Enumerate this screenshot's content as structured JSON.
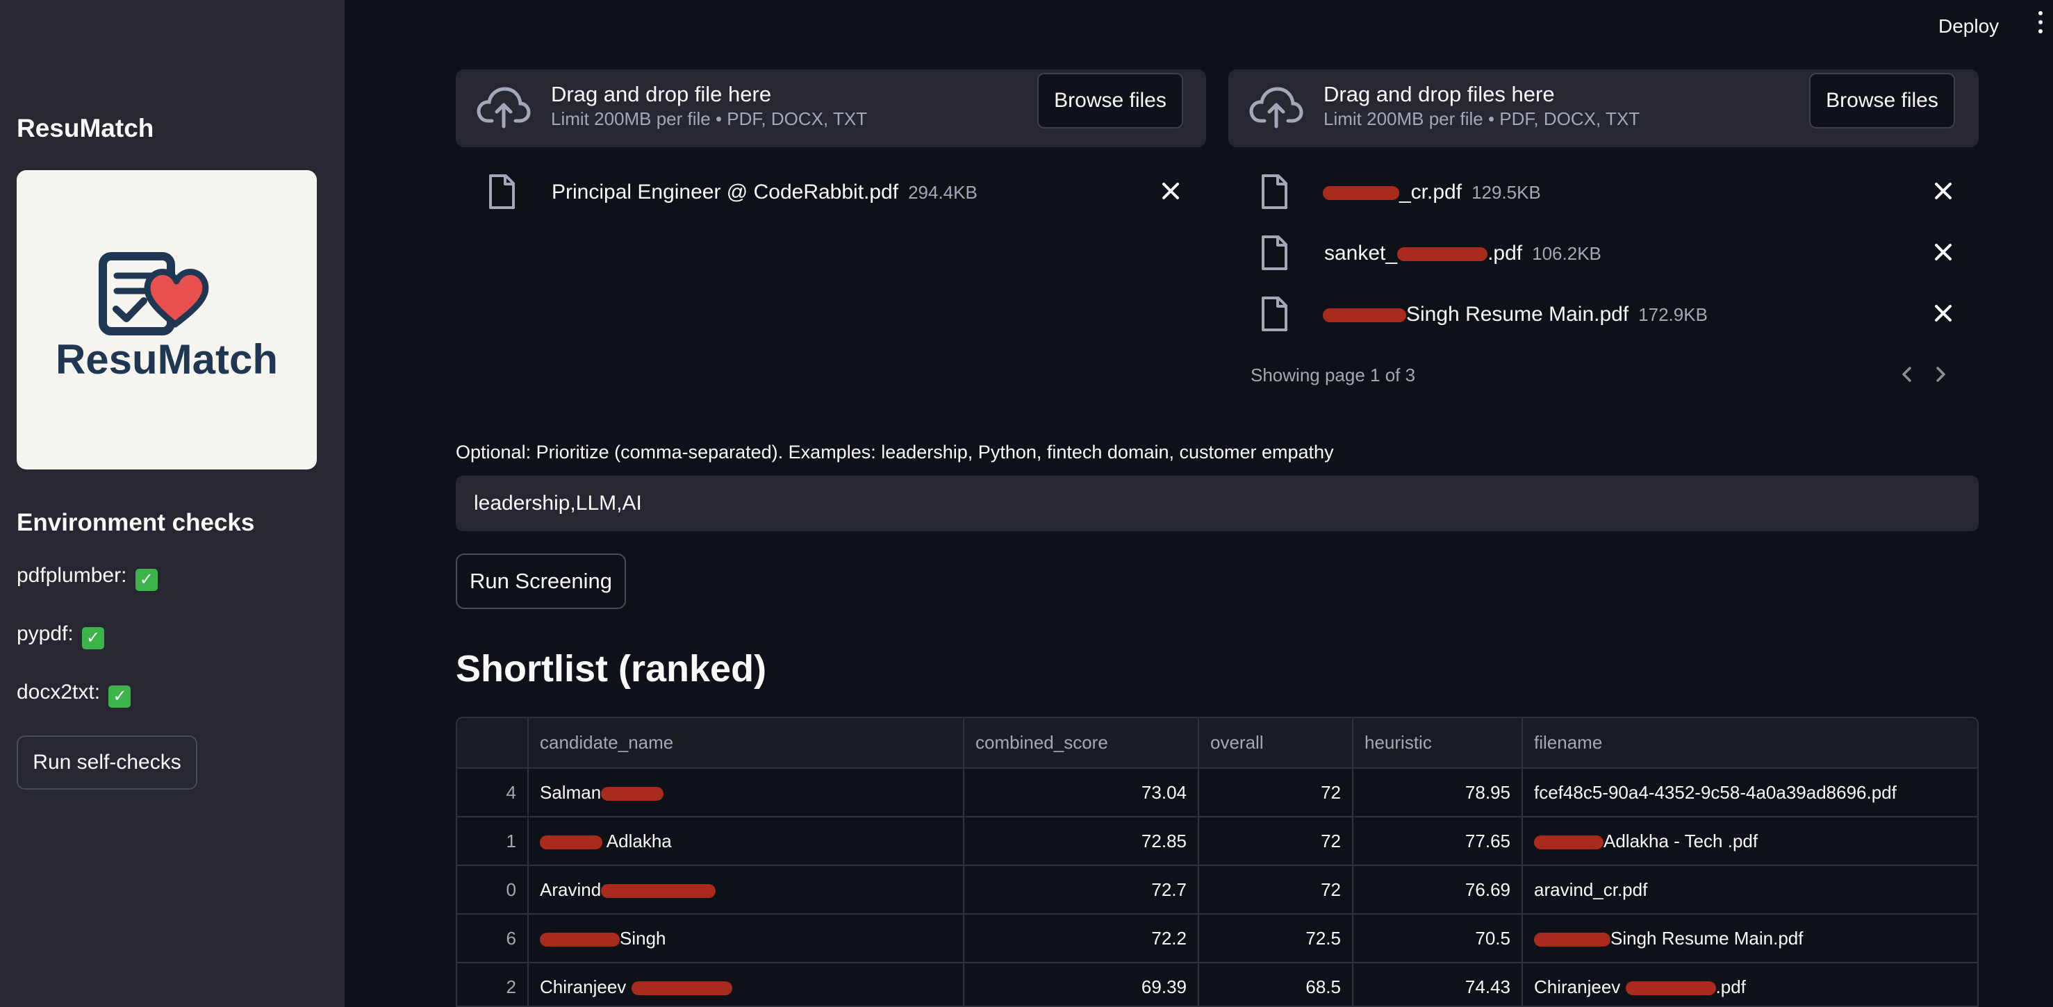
{
  "sidebar": {
    "app_title": "ResuMatch",
    "logo_text": "ResuMatch",
    "env_title": "Environment checks",
    "checks": [
      {
        "label": "pdfplumber:",
        "status": "✓"
      },
      {
        "label": "pypdf:",
        "status": "✓"
      },
      {
        "label": "docx2txt:",
        "status": "✓"
      }
    ],
    "self_check_button": "Run self-checks"
  },
  "header": {
    "deploy": "Deploy"
  },
  "jd_uploader": {
    "title": "Drag and drop file here",
    "limit": "Limit 200MB per file • PDF, DOCX, TXT",
    "browse": "Browse files",
    "files": [
      {
        "name": "Principal Engineer @ CodeRabbit.pdf",
        "size": "294.4KB"
      }
    ]
  },
  "resume_uploader": {
    "title": "Drag and drop files here",
    "limit": "Limit 200MB per file • PDF, DOCX, TXT",
    "browse": "Browse files",
    "files": [
      {
        "name": "_cr.pdf",
        "size": "129.5KB"
      },
      {
        "name_prefix": "sanket_",
        "name": ".pdf",
        "size": "106.2KB"
      },
      {
        "name": "Singh Resume Main.pdf",
        "size": "172.9KB"
      }
    ],
    "paging": "Showing page 1 of 3"
  },
  "prioritize": {
    "label": "Optional: Prioritize (comma-separated). Examples: leadership, Python, fintech domain, customer empathy",
    "value": "leadership,LLM,AI"
  },
  "run_button": "Run Screening",
  "shortlist": {
    "title": "Shortlist (ranked)",
    "columns": [
      "",
      "candidate_name",
      "combined_score",
      "overall",
      "heuristic",
      "filename"
    ],
    "rows": [
      {
        "idx": "4",
        "name": "Salman",
        "combined": "73.04",
        "overall": "72",
        "heuristic": "78.95",
        "filename": "fcef48c5-90a4-4352-9c58-4a0a39ad8696.pdf"
      },
      {
        "idx": "1",
        "name": "Adlakha",
        "combined": "72.85",
        "overall": "72",
        "heuristic": "77.65",
        "filename": "Adlakha - Tech .pdf"
      },
      {
        "idx": "0",
        "name": "Aravind",
        "combined": "72.7",
        "overall": "72",
        "heuristic": "76.69",
        "filename": "aravind_cr.pdf"
      },
      {
        "idx": "6",
        "name": "Singh",
        "combined": "72.2",
        "overall": "72.5",
        "heuristic": "70.5",
        "filename": "Singh Resume Main.pdf"
      },
      {
        "idx": "2",
        "name": "Chiranjeev",
        "combined": "69.39",
        "overall": "68.5",
        "heuristic": "74.43",
        "filename": ".pdf"
      }
    ]
  }
}
